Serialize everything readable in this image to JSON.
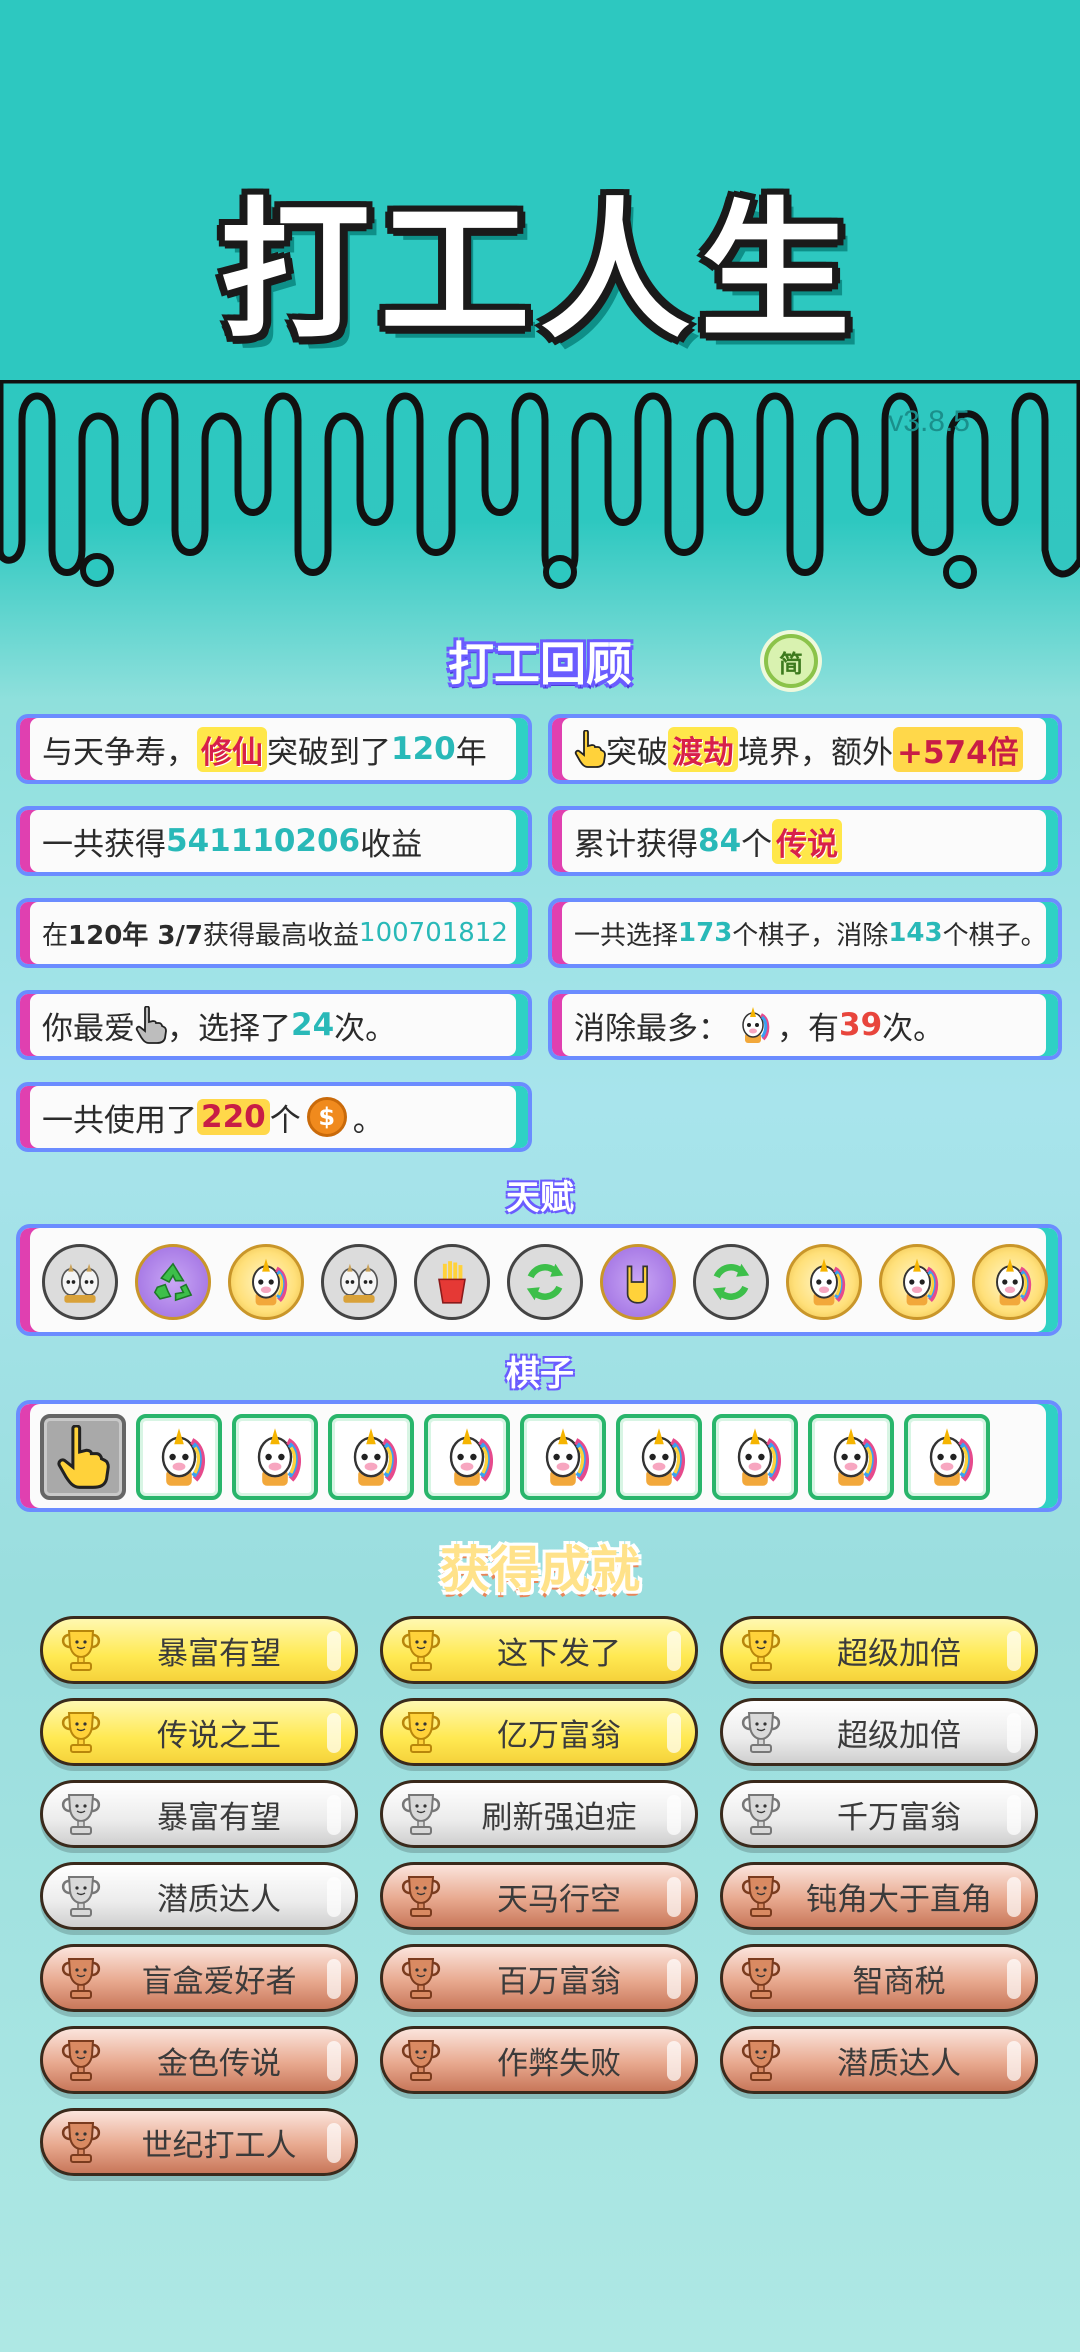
{
  "app": {
    "title": "打工人生",
    "version": "v3.8.5"
  },
  "review": {
    "title": "打工回顾",
    "lang_button": "简",
    "stats": [
      {
        "pre": "与天争寿，",
        "badge": "修仙",
        "mid": "突破到了",
        "num": "120",
        "post": "年"
      },
      {
        "pre": "突破",
        "badge": "渡劫",
        "mid": "境界，额外",
        "num": "+574倍",
        "post": ""
      },
      {
        "pre": "一共获得",
        "num": "541110206",
        "post": "收益"
      },
      {
        "pre": "累计获得",
        "num": "84",
        "mid": "个",
        "badge": "传说"
      },
      {
        "pre": "在 ",
        "bold": "120年 3/7",
        "mid": " 获得最高收益",
        "num": "100701812"
      },
      {
        "pre": "一共选择",
        "num1": "173",
        "mid": "个棋子，消除",
        "num2": "143",
        "post": "个棋子。"
      },
      {
        "pre": "你最爱",
        "mid": "，选择了",
        "num": "24",
        "post": "次。"
      },
      {
        "pre": "消除最多：",
        "mid": "，有",
        "num": "39",
        "post": "次。"
      },
      {
        "pre": "一共使用了",
        "num": "220",
        "mid": "个",
        "coin": "$",
        "post": "。"
      }
    ]
  },
  "talents": {
    "title": "天赋",
    "items": [
      {
        "icon": "twin-unicorn-gray-icon",
        "style": "gray"
      },
      {
        "icon": "recycle-icon",
        "style": "purple"
      },
      {
        "icon": "unicorn-gold-icon",
        "style": "gold"
      },
      {
        "icon": "twin-unicorn-gray-icon",
        "style": "gray"
      },
      {
        "icon": "fries-icon",
        "style": "gray"
      },
      {
        "icon": "refresh-icon",
        "style": "gray"
      },
      {
        "icon": "rock-hand-icon",
        "style": "purple"
      },
      {
        "icon": "refresh-icon",
        "style": "gray"
      },
      {
        "icon": "unicorn-gold-icon",
        "style": "gold"
      },
      {
        "icon": "unicorn-gold-icon",
        "style": "gold"
      },
      {
        "icon": "unicorn-gold-icon",
        "style": "gold"
      }
    ]
  },
  "pieces": {
    "title": "棋子",
    "items": [
      "pointing-hand-icon",
      "unicorn-icon",
      "unicorn-icon",
      "unicorn-icon",
      "unicorn-icon",
      "unicorn-icon",
      "unicorn-icon",
      "unicorn-icon",
      "unicorn-icon",
      "unicorn-icon"
    ]
  },
  "achievements": {
    "title": "获得成就",
    "items": [
      {
        "label": "暴富有望",
        "tier": "gold"
      },
      {
        "label": "这下发了",
        "tier": "gold"
      },
      {
        "label": "超级加倍",
        "tier": "gold"
      },
      {
        "label": "传说之王",
        "tier": "gold"
      },
      {
        "label": "亿万富翁",
        "tier": "gold"
      },
      {
        "label": "超级加倍",
        "tier": "silver"
      },
      {
        "label": "暴富有望",
        "tier": "silver"
      },
      {
        "label": "刷新强迫症",
        "tier": "silver"
      },
      {
        "label": "千万富翁",
        "tier": "silver"
      },
      {
        "label": "潜质达人",
        "tier": "silver"
      },
      {
        "label": "天马行空",
        "tier": "bronze"
      },
      {
        "label": "钝角大于直角",
        "tier": "bronze"
      },
      {
        "label": "盲盒爱好者",
        "tier": "bronze"
      },
      {
        "label": "百万富翁",
        "tier": "bronze"
      },
      {
        "label": "智商税",
        "tier": "bronze"
      },
      {
        "label": "金色传说",
        "tier": "bronze"
      },
      {
        "label": "作弊失败",
        "tier": "bronze"
      },
      {
        "label": "潜质达人",
        "tier": "bronze"
      },
      {
        "label": "世纪打工人",
        "tier": "bronze"
      }
    ]
  },
  "colors": {
    "teal_bg": "#2dc8c0",
    "card_border": "#6b8cff",
    "card_left": "#e040b0",
    "card_right": "#2fd1c4",
    "highlight": "#29b9b8",
    "highlight_red": "#e8453c"
  }
}
